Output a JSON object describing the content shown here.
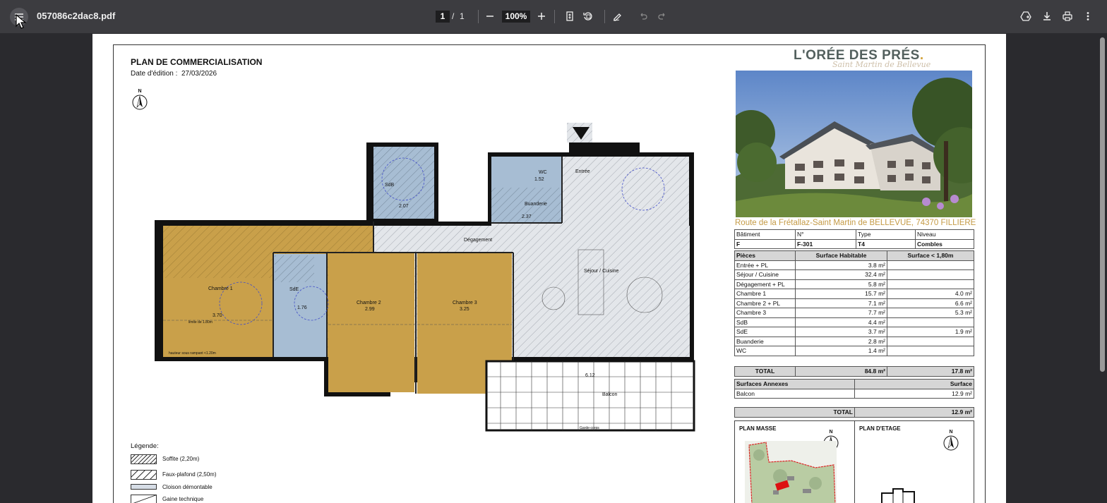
{
  "toolbar": {
    "title": "057086c2dac8.pdf",
    "page_current": "1",
    "page_separator": "/",
    "page_total": "1",
    "zoom": "100%"
  },
  "document": {
    "title": "PLAN DE COMMERCIALISATION",
    "date_label": "Date d'édition :",
    "date_value": "27/03/2026",
    "north": "N",
    "brand": "L'ORÉE DES PRÉS",
    "brand_dot": ".",
    "brand_script": "Saint Martin de Bellevue",
    "address": "Route de la Frétallaz-Saint Martin de BELLEVUE, 74370 FILLIERE"
  },
  "lot": {
    "headers": [
      "Bâtiment",
      "N°",
      "Type",
      "Niveau"
    ],
    "values": [
      "F",
      "F-301",
      "T4",
      "Combles"
    ]
  },
  "rooms": {
    "headers": [
      "Pièces",
      "Surface Habitable",
      "Surface < 1,80m"
    ],
    "rows": [
      {
        "name": "Entrée + PL",
        "surface": "3.8 m²",
        "low": ""
      },
      {
        "name": "Séjour / Cuisine",
        "surface": "32.4 m²",
        "low": ""
      },
      {
        "name": "Dégagement + PL",
        "surface": "5.8 m²",
        "low": ""
      },
      {
        "name": "Chambre 1",
        "surface": "15.7 m²",
        "low": "4.0 m²"
      },
      {
        "name": "Chambre 2 + PL",
        "surface": "7.1 m²",
        "low": "6.6 m²"
      },
      {
        "name": "Chambre 3",
        "surface": "7.7 m²",
        "low": "5.3 m²"
      },
      {
        "name": "SdB",
        "surface": "4.4 m²",
        "low": ""
      },
      {
        "name": "SdE",
        "surface": "3.7 m²",
        "low": "1.9 m²"
      },
      {
        "name": "Buanderie",
        "surface": "2.8 m²",
        "low": ""
      },
      {
        "name": "WC",
        "surface": "1.4 m²",
        "low": ""
      }
    ],
    "total_label": "TOTAL",
    "total_surface": "84.8 m²",
    "total_low": "17.8 m²"
  },
  "annexes": {
    "header_left": "Surfaces Annexes",
    "header_right": "Surface",
    "rows": [
      {
        "name": "Balcon",
        "surface": "12.9 m²"
      }
    ],
    "total_label": "TOTAL",
    "total_value": "12.9 m²"
  },
  "plans": {
    "masse_label": "PLAN MASSE",
    "etage_label": "PLAN D'ETAGE"
  },
  "legend": {
    "title": "Légende:",
    "items": [
      {
        "label": "Soffite (2,20m)"
      },
      {
        "label": "Faux-plafond (2,50m)"
      },
      {
        "label": "Cloison démontable"
      },
      {
        "label": "Gaine technique"
      }
    ]
  },
  "floorplan": {
    "rooms": [
      {
        "label": "Chambre 1",
        "area": "3.70"
      },
      {
        "label": "SdE",
        "area": "1.76"
      },
      {
        "label": "Chambre 2",
        "area": "2.99"
      },
      {
        "label": "Chambre 3",
        "area": "3.25"
      },
      {
        "label": "Dégagement"
      },
      {
        "label": "SdB",
        "area": "2.07"
      },
      {
        "label": "WC",
        "area": "1.52"
      },
      {
        "label": "Buanderie",
        "area": "2.37"
      },
      {
        "label": "Entrée"
      },
      {
        "label": "Séjour / Cuisine"
      },
      {
        "label": "Balcon",
        "area": "6.12"
      }
    ],
    "annotations": [
      "Garde-corps",
      "hauteur sous rampant <1.20m",
      "limite de 1.80m"
    ]
  },
  "colors": {
    "toolbar_bg": "#3c3c40",
    "viewer_bg": "#2a2a2e",
    "room_gold": "#c9a04a",
    "room_blue": "#a7bdd3",
    "hatch_gray": "#d9dde2",
    "address": "#c49a45"
  }
}
